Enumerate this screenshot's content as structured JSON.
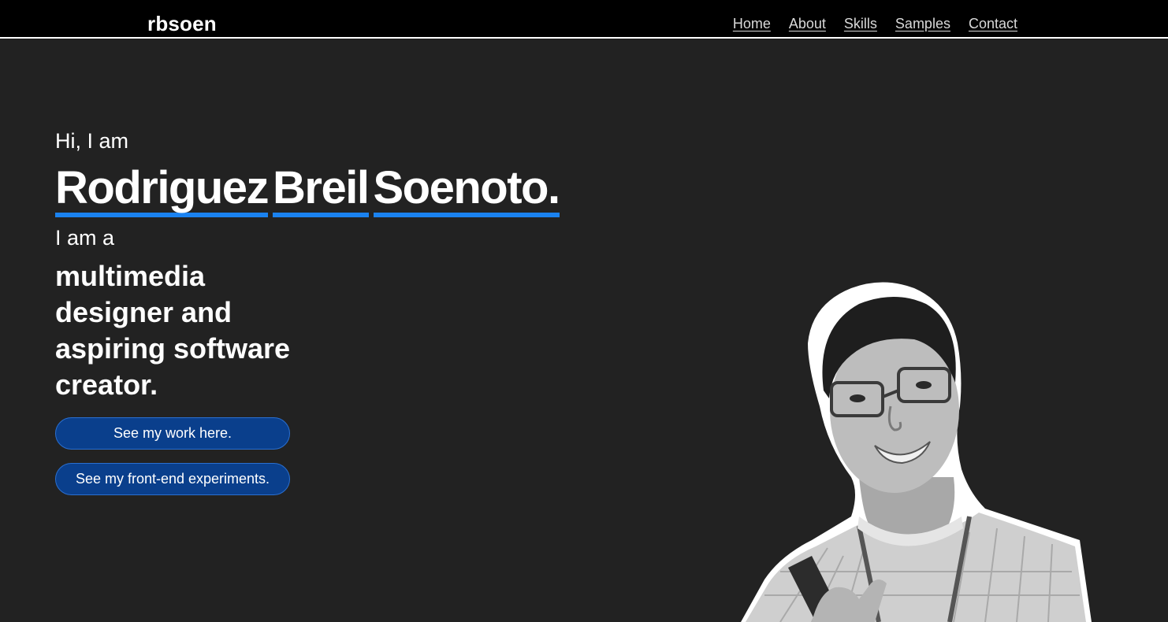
{
  "header": {
    "brand": "rbsoen",
    "nav": [
      "Home",
      "About",
      "Skills",
      "Samples",
      "Contact"
    ]
  },
  "hero": {
    "greeting": "Hi, I am",
    "name": [
      "Rodriguez",
      "Breil",
      "Soenoto."
    ],
    "role_intro": "I am a",
    "role_description": "multimedia designer and aspiring software creator.",
    "buttons": {
      "work": "See my work here.",
      "experiments": "See my front-end experiments."
    }
  },
  "colors": {
    "background": "#222222",
    "navbar": "#000000",
    "accent": "#1a82f0",
    "button": "#0a3f8c"
  }
}
